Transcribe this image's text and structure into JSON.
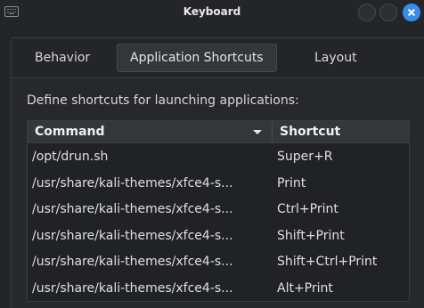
{
  "window": {
    "title": "Keyboard",
    "icon": "keyboard-icon"
  },
  "tabs": [
    {
      "label": "Behavior",
      "active": false
    },
    {
      "label": "Application Shortcuts",
      "active": true
    },
    {
      "label": "Layout",
      "active": false
    }
  ],
  "page": {
    "description": "Define shortcuts for launching applications:"
  },
  "table": {
    "columns": {
      "command": "Command",
      "shortcut": "Shortcut"
    },
    "rows": [
      {
        "command": "/opt/drun.sh",
        "shortcut": "Super+R"
      },
      {
        "command": "/usr/share/kali-themes/xfce4-s...",
        "shortcut": "Print"
      },
      {
        "command": "/usr/share/kali-themes/xfce4-s...",
        "shortcut": "Ctrl+Print"
      },
      {
        "command": "/usr/share/kali-themes/xfce4-s...",
        "shortcut": "Shift+Print"
      },
      {
        "command": "/usr/share/kali-themes/xfce4-s...",
        "shortcut": "Shift+Ctrl+Print"
      },
      {
        "command": "/usr/share/kali-themes/xfce4-s...",
        "shortcut": "Alt+Print"
      }
    ]
  },
  "colors": {
    "background": "#232529",
    "accent": "#3b8bea",
    "header": "#33363b"
  }
}
